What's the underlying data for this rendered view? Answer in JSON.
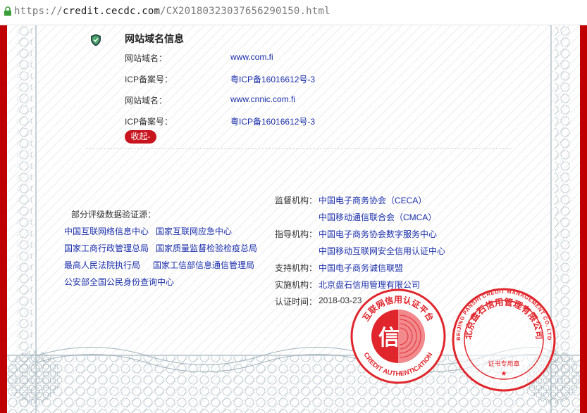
{
  "browser": {
    "url_scheme": "https://",
    "url_host": "credit.cecdc.com",
    "url_path": "/CX20180323037656290150.html"
  },
  "colors": {
    "frame_red": "#c00000",
    "link_blue": "#1a2eaa",
    "seal_red": "#e0262c",
    "button_red": "#c8141f"
  },
  "section": {
    "icon": "shield-check-icon",
    "title": "网站域名信息",
    "rows": [
      {
        "label": "网站域名：",
        "value": "www.com.fi"
      },
      {
        "label": "ICP备案号：",
        "value": "粤ICP备16016612号-3"
      },
      {
        "label": "网站域名：",
        "value": "www.cnnic.com.fi"
      },
      {
        "label": "ICP备案号：",
        "value": "粤ICP备16016612号-3"
      }
    ],
    "collapse_label": "收起-"
  },
  "sources": {
    "title": "部分评级数据验证源：",
    "links": [
      "中国互联网络信息中心",
      "国家互联网应急中心",
      "国家工商行政管理总局",
      "国家质量监督检验检疫总局",
      "最高人民法院执行局",
      "国家工信部信息通信管理局",
      "公安部全国公民身份查询中心"
    ]
  },
  "authority": {
    "supervisor_label": "监督机构：",
    "supervisors": [
      "中国电子商务协会（CECA）",
      "中国移动通信联合会（CMCA）"
    ],
    "guide_label": "指导机构：",
    "guides": [
      "中国电子商务协会数字服务中心",
      "中国移动互联网安全信用认证中心"
    ],
    "support_label": "支持机构：",
    "support": "中国电子商务诚信联盟",
    "implement_label": "实施机构：",
    "implement": "北京盘石信用管理有限公司",
    "date_label": "认证时间：",
    "date": "2018-03-23"
  },
  "seals": {
    "left": {
      "top_text": "互联网信用认证平台",
      "bottom_text": "CREDIT AUTHENTICATION",
      "center_char": "信"
    },
    "right": {
      "outer_text": "BEIJING PANSHI CREDIT MANAGEMENT CO. LTD",
      "inner_text": "北京盘石信用管理有限公司",
      "bottom_text": "证书专用章",
      "star": "★"
    }
  }
}
